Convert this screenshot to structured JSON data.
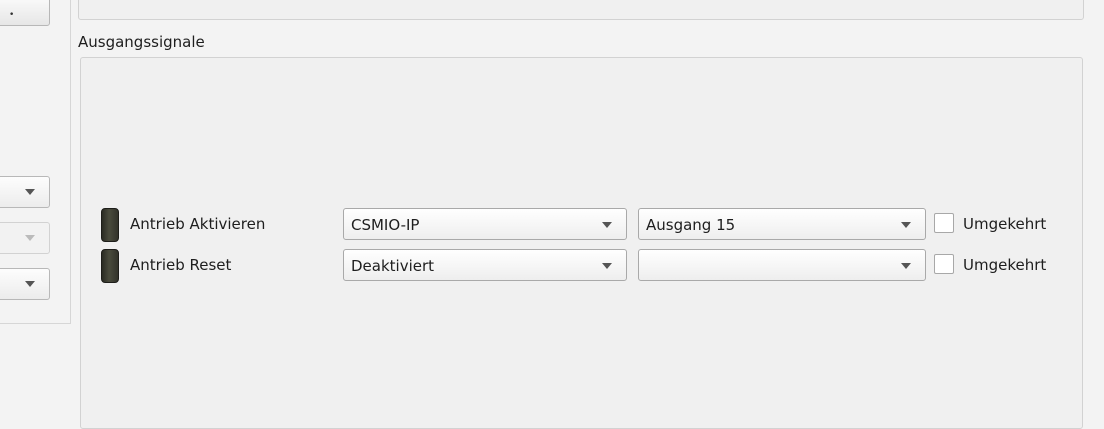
{
  "left_panel": {
    "top_button_glyph": "•",
    "dropdowns": [
      {
        "enabled": true
      },
      {
        "enabled": false
      },
      {
        "enabled": true
      }
    ]
  },
  "output_group": {
    "title": "Ausgangssignale",
    "rows": [
      {
        "label": "Antrieb Aktivieren",
        "device": "CSMIO-IP",
        "output": "Ausgang 15",
        "inverted_label": "Umgekehrt",
        "inverted": false
      },
      {
        "label": "Antrieb Reset",
        "device": "Deaktiviert",
        "output": "",
        "inverted_label": "Umgekehrt",
        "inverted": false
      }
    ]
  },
  "colors": {
    "led": "#3a3b30",
    "background": "#f3f3f3"
  }
}
